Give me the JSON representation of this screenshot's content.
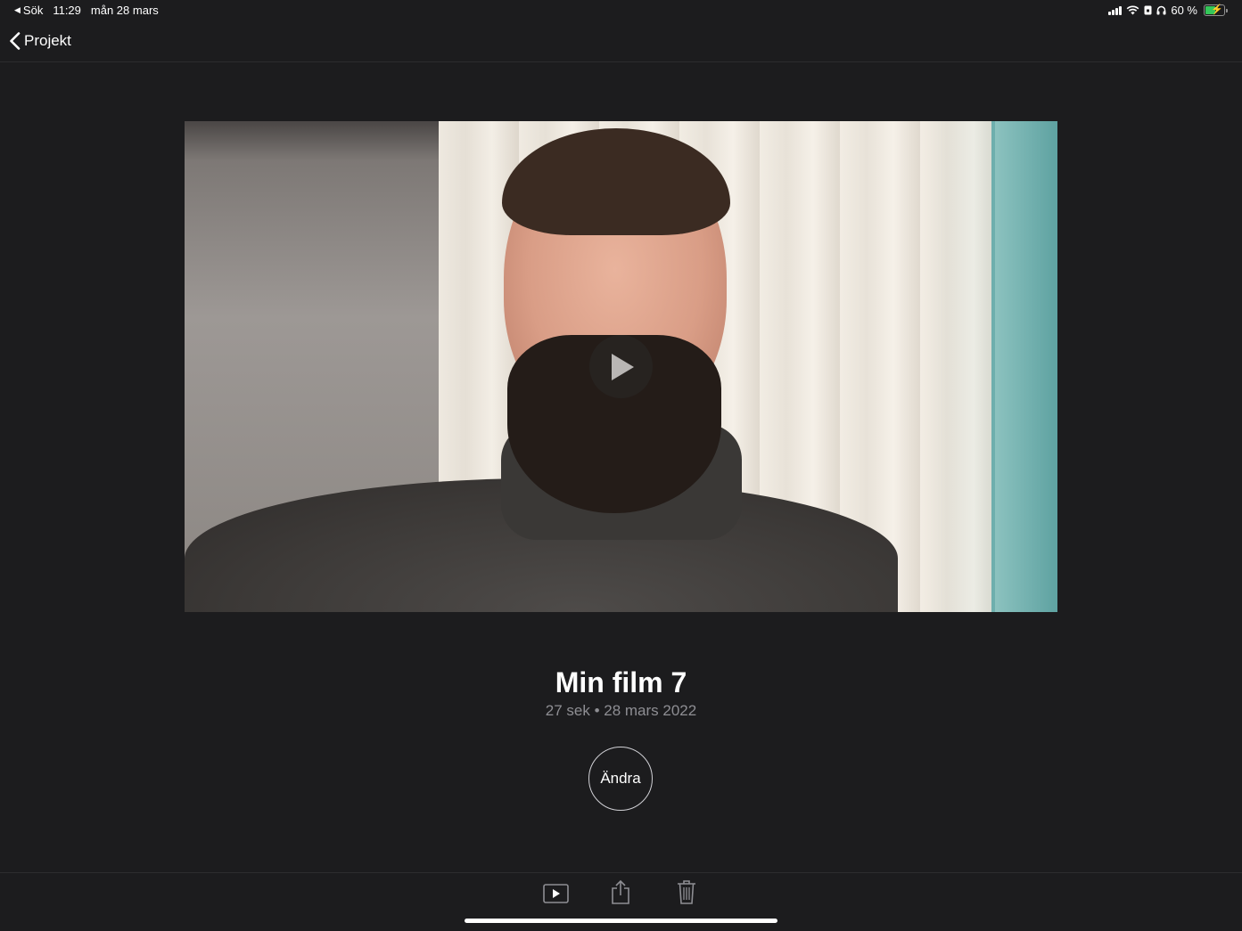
{
  "status_bar": {
    "back_app": "Sök",
    "time": "11:29",
    "date": "mån 28 mars",
    "battery_percent": "60 %",
    "battery_level": 0.6,
    "charging": true
  },
  "nav": {
    "back_label": "Projekt"
  },
  "project": {
    "title": "Min film 7",
    "meta": "27 sek • 28 mars 2022",
    "edit_label": "Ändra"
  },
  "toolbar": {
    "items": [
      "play-icon",
      "share-icon",
      "trash-icon"
    ]
  },
  "colors": {
    "background": "#1c1c1e",
    "secondary_text": "#8e8e93",
    "battery_green": "#34c759"
  }
}
